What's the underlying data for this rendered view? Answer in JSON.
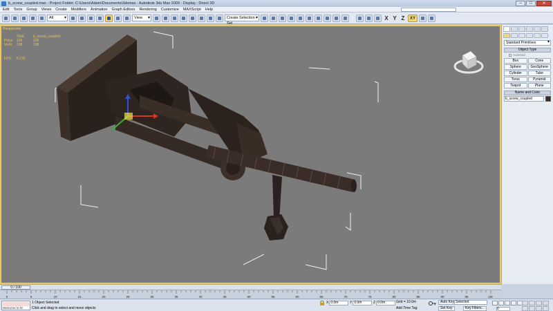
{
  "titlebar": {
    "title": "b_screw_coupled.max    -  Project Folder: C:\\Users\\Adam\\Documents\\3dsmax      -   Autodesk 3ds Max  2009       -   Display : Direct 3D"
  },
  "menubar": {
    "items": [
      "Edit",
      "Tools",
      "Group",
      "Views",
      "Create",
      "Modifiers",
      "Animation",
      "Graph Editors",
      "Rendering",
      "Customize",
      "MAXScript",
      "Help"
    ]
  },
  "toolbar": {
    "selection_filter": "All",
    "reference_coord": "View",
    "named_selection_placeholder": "Create Selection Set",
    "axis_letters": [
      "X",
      "Y",
      "Z",
      "XY"
    ]
  },
  "viewport": {
    "label": "Perspective",
    "stats": {
      "header": [
        "Total",
        "b_screw_coupled"
      ],
      "rows": [
        [
          "Polys",
          "226",
          "226"
        ],
        [
          "Verts",
          "198",
          "198"
        ]
      ],
      "fps_label": "FPS:",
      "fps_value": "6.276"
    }
  },
  "command_panel": {
    "primitive_type": "Standard Primitives",
    "object_type_title": "Object Type",
    "autogrid_label": "AutoGrid",
    "objects": [
      "Box",
      "Cone",
      "Sphere",
      "GeoSphere",
      "Cylinder",
      "Tube",
      "Torus",
      "Pyramid",
      "Teapot",
      "Plane"
    ],
    "name_color_title": "Name and Color",
    "object_name": "b_screw_coupled",
    "object_color": "#3b2e26"
  },
  "timeline": {
    "thumb_label": "0 / 100",
    "ticks": [
      "0",
      "5",
      "10",
      "15",
      "20",
      "25",
      "30",
      "35",
      "40",
      "45",
      "50",
      "55",
      "60",
      "65",
      "70",
      "75",
      "80",
      "85",
      "90",
      "95",
      "100"
    ]
  },
  "statusbar": {
    "maxscript_label": "Welcome to M",
    "status_line": "1 Object Selected",
    "prompt_line": "Click and drag to select and move objects",
    "x_label": "X",
    "x_value": "0.0m",
    "y_label": "Y",
    "y_value": "0.0m",
    "z_label": "Z",
    "z_value": "0.0m",
    "grid_readout": "Grid = 10.0m",
    "add_time_tag": "Add Time Tag",
    "auto_key": "Auto Key",
    "set_key": "Set Key",
    "selected_dropdown": "Selected",
    "key_filters": "Key Filters...",
    "frame": "0"
  }
}
